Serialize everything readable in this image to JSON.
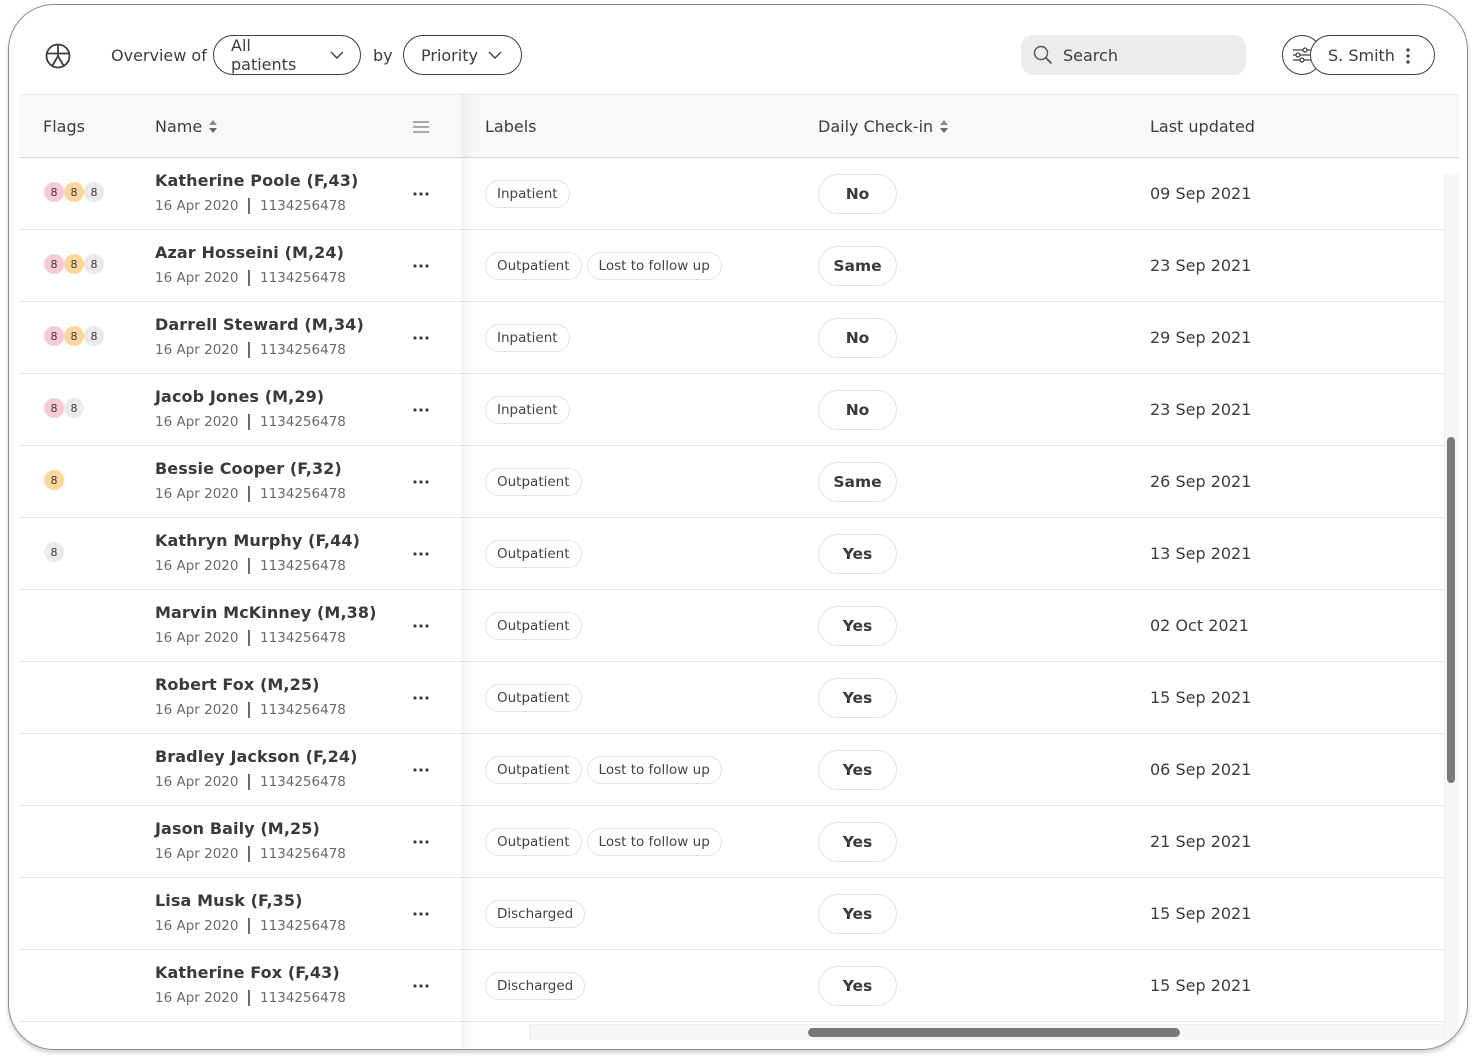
{
  "header": {
    "overview_label": "Overview of",
    "scope_select": "All patients",
    "by_label": "by",
    "sort_select": "Priority",
    "search_placeholder": "Search",
    "user_name": "S. Smith"
  },
  "colors": {
    "flag_red": "#f9c9d4",
    "flag_orange": "#fdd79b",
    "flag_grey": "#ebebeb",
    "scrollbar": "#7a7a7a"
  },
  "table": {
    "columns": {
      "flags": "Flags",
      "name": "Name",
      "labels": "Labels",
      "daily_checkin": "Daily Check-in",
      "last_updated": "Last updated"
    },
    "rows": [
      {
        "flags": [
          {
            "color": "red",
            "count": "8"
          },
          {
            "color": "orange",
            "count": "8"
          },
          {
            "color": "grey",
            "count": "8"
          }
        ],
        "name": "Katherine Poole (F,43)",
        "date": "16 Apr 2020",
        "id": "1134256478",
        "labels": [
          "Inpatient"
        ],
        "checkin": "No",
        "updated": "09 Sep 2021"
      },
      {
        "flags": [
          {
            "color": "red",
            "count": "8"
          },
          {
            "color": "orange",
            "count": "8"
          },
          {
            "color": "grey",
            "count": "8"
          }
        ],
        "name": "Azar Hosseini (M,24)",
        "date": "16 Apr 2020",
        "id": "1134256478",
        "labels": [
          "Outpatient",
          "Lost to follow up"
        ],
        "checkin": "Same",
        "updated": "23 Sep 2021"
      },
      {
        "flags": [
          {
            "color": "red",
            "count": "8"
          },
          {
            "color": "orange",
            "count": "8"
          },
          {
            "color": "grey",
            "count": "8"
          }
        ],
        "name": "Darrell Steward (M,34)",
        "date": "16 Apr 2020",
        "id": "1134256478",
        "labels": [
          "Inpatient"
        ],
        "checkin": "No",
        "updated": "29 Sep 2021"
      },
      {
        "flags": [
          {
            "color": "red",
            "count": "8"
          },
          {
            "color": "grey",
            "count": "8"
          }
        ],
        "name": "Jacob Jones (M,29)",
        "date": "16 Apr 2020",
        "id": "1134256478",
        "labels": [
          "Inpatient"
        ],
        "checkin": "No",
        "updated": "23 Sep 2021"
      },
      {
        "flags": [
          {
            "color": "orange",
            "count": "8"
          }
        ],
        "name": "Bessie Cooper (F,32)",
        "date": "16 Apr 2020",
        "id": "1134256478",
        "labels": [
          "Outpatient"
        ],
        "checkin": "Same",
        "updated": "26 Sep 2021"
      },
      {
        "flags": [
          {
            "color": "grey",
            "count": "8"
          }
        ],
        "name": "Kathryn Murphy (F,44)",
        "date": "16 Apr 2020",
        "id": "1134256478",
        "labels": [
          "Outpatient"
        ],
        "checkin": "Yes",
        "updated": "13 Sep 2021"
      },
      {
        "flags": [],
        "name": "Marvin McKinney (M,38)",
        "date": "16 Apr 2020",
        "id": "1134256478",
        "labels": [
          "Outpatient"
        ],
        "checkin": "Yes",
        "updated": "02 Oct 2021"
      },
      {
        "flags": [],
        "name": "Robert Fox (M,25)",
        "date": "16 Apr 2020",
        "id": "1134256478",
        "labels": [
          "Outpatient"
        ],
        "checkin": "Yes",
        "updated": "15 Sep 2021"
      },
      {
        "flags": [],
        "name": "Bradley Jackson (F,24)",
        "date": "16 Apr 2020",
        "id": "1134256478",
        "labels": [
          "Outpatient",
          "Lost to follow up"
        ],
        "checkin": "Yes",
        "updated": "06 Sep 2021"
      },
      {
        "flags": [],
        "name": "Jason Baily (M,25)",
        "date": "16 Apr 2020",
        "id": "1134256478",
        "labels": [
          "Outpatient",
          "Lost to follow up"
        ],
        "checkin": "Yes",
        "updated": "21 Sep 2021"
      },
      {
        "flags": [],
        "name": "Lisa Musk (F,35)",
        "date": "16 Apr 2020",
        "id": "1134256478",
        "labels": [
          "Discharged"
        ],
        "checkin": "Yes",
        "updated": "15 Sep 2021"
      },
      {
        "flags": [],
        "name": "Katherine Fox (F,43)",
        "date": "16 Apr 2020",
        "id": "1134256478",
        "labels": [
          "Discharged"
        ],
        "checkin": "Yes",
        "updated": "15 Sep 2021"
      }
    ]
  }
}
